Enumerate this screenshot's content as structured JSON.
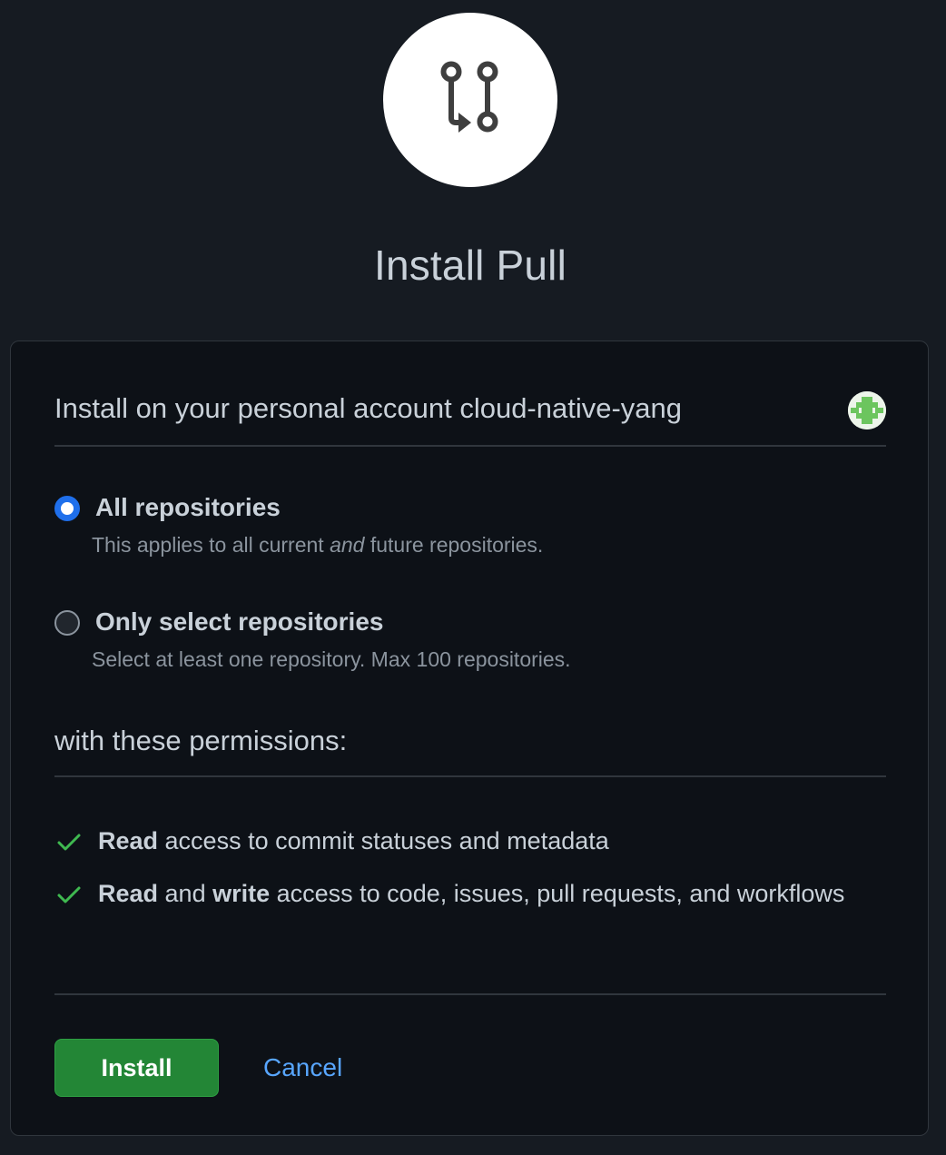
{
  "app": {
    "title": "Install Pull",
    "logo_icon": "git-pull-request-icon"
  },
  "account": {
    "label": "Install on your personal account cloud-native-yang",
    "avatar_icon": "identicon-avatar"
  },
  "repository_options": [
    {
      "label": "All repositories",
      "desc_before": "This applies to all current ",
      "desc_emphasis": "and",
      "desc_after": " future repositories.",
      "selected": true
    },
    {
      "label": "Only select repositories",
      "desc": "Select at least one repository. Max 100 repositories.",
      "selected": false
    }
  ],
  "permissions": {
    "heading": "with these permissions:",
    "items": [
      {
        "bold1": "Read",
        "text1": " access to commit statuses and metadata"
      },
      {
        "bold1": "Read",
        "text1": " and ",
        "bold2": "write",
        "text2": " access to code, issues, pull requests, and workflows"
      }
    ]
  },
  "actions": {
    "install_label": "Install",
    "cancel_label": "Cancel"
  },
  "colors": {
    "background": "#161b22",
    "card_background": "#0d1117",
    "accent_blue": "#1f6feb",
    "link_blue": "#58a6ff",
    "install_green": "#238636",
    "check_green": "#3fb950"
  }
}
